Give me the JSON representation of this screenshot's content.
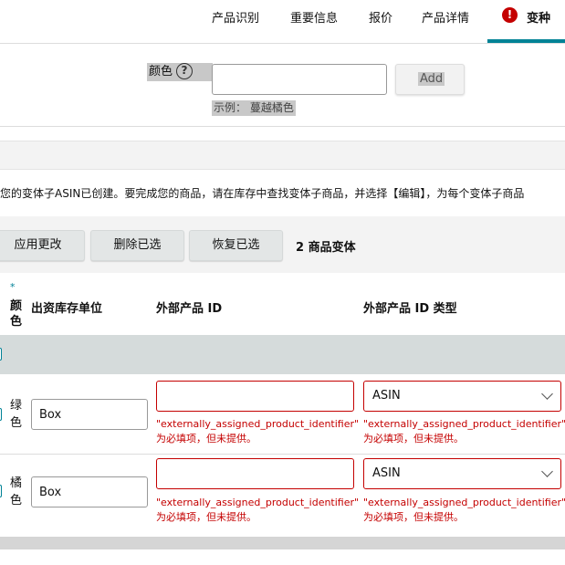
{
  "tabs": [
    {
      "label": "产品识别"
    },
    {
      "label": "重要信息"
    },
    {
      "label": "报价"
    },
    {
      "label": "产品详情"
    },
    {
      "label": "变种"
    }
  ],
  "alert_glyph": "!",
  "variation_theme": {
    "label": "颜色",
    "help_glyph": "?",
    "input_value": "",
    "add_label": "Add",
    "example": "示例：  蔓越橘色"
  },
  "notice": "您的变体子ASIN已创建。要完成您的商品，请在库存中查找变体子商品，并选择【编辑】，为每个变体子商品",
  "actions": {
    "apply": "应用更改",
    "delete": "删除已选",
    "restore": "恢复已选",
    "count": "2 商品变体"
  },
  "table": {
    "required_mark": "*",
    "columns": {
      "color": "颜色",
      "sku": "出资库存单位",
      "product_id": "外部产品 ID",
      "product_id_type": "外部产品 ID 类型"
    },
    "rows": [
      {
        "color": "绿色",
        "sku": "Box",
        "product_id": "",
        "product_id_type": "ASIN",
        "error_key": "\"externally_assigned_product_identifier\"",
        "error_msg": "为必填项，但未提供。"
      },
      {
        "color": "橘色",
        "sku": "Box",
        "product_id": "",
        "product_id_type": "ASIN",
        "error_key": "\"externally_assigned_product_identifier\"",
        "error_msg": "为必填项，但未提供。"
      }
    ]
  },
  "colors": {
    "accent": "#008296",
    "error": "#c40000",
    "button_bg": "#e3e6e6",
    "band_bg": "#f3f3f3",
    "filter_bg": "#d5dbdb"
  }
}
